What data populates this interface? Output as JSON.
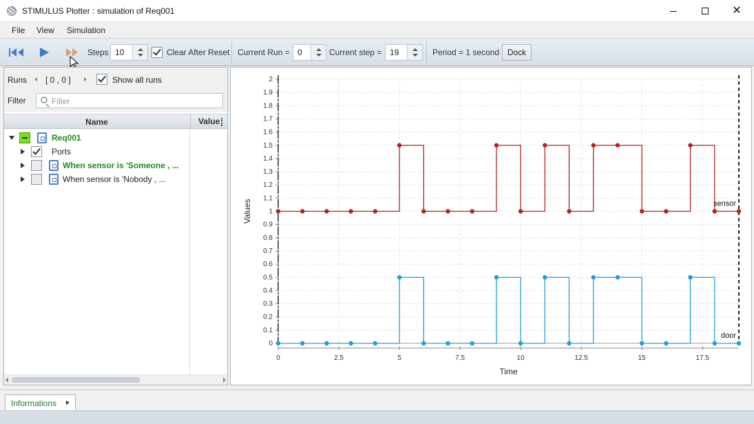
{
  "window": {
    "title": "STIMULUS Plotter : simulation of Req001"
  },
  "menu": {
    "items": [
      "File",
      "View",
      "Simulation"
    ]
  },
  "toolbar": {
    "steps_label": "Steps",
    "steps_value": "10",
    "clear_after_reset_label": "Clear After Reset",
    "clear_after_reset_checked": true,
    "current_run_label": "Current Run =",
    "current_run_value": "0",
    "current_step_label": "Current step =",
    "current_step_value": "19",
    "period_label": "Period = 1 second",
    "dock_label": "Dock",
    "icons": [
      "rewind-icon",
      "play-icon",
      "fast-forward-icon"
    ]
  },
  "runs_panel": {
    "runs_label": "Runs",
    "runs_range": "[ 0 , 0 ]",
    "show_all_runs_label": "Show all runs",
    "show_all_runs_checked": true,
    "filter_label": "Filter",
    "filter_placeholder": "Filter",
    "columns": {
      "name": "Name",
      "value": "Value"
    },
    "tree": [
      {
        "label": "Req001",
        "expanded": true,
        "checked": "partial",
        "bold": true,
        "color": "#1f8a1f"
      },
      {
        "label": "Ports",
        "expanded": false,
        "checked": true,
        "bold": false
      },
      {
        "label": "When  sensor is  'Someone , ...",
        "expanded": false,
        "checked": false,
        "bold": true,
        "color": "#1f8a1f"
      },
      {
        "label": "When  sensor is  'Nobody , ...",
        "expanded": false,
        "checked": false,
        "bold": false
      }
    ]
  },
  "info_tab": {
    "label": "Informations"
  },
  "colors": {
    "sensor": "#b22222",
    "door": "#1e9fd3",
    "accent_green": "#1f8a1f"
  },
  "chart_data": {
    "type": "line",
    "step": true,
    "xlabel": "Time",
    "ylabel": "Values",
    "xlim": [
      0,
      19
    ],
    "ylim": [
      0,
      2
    ],
    "x_ticks": [
      "0",
      "2.5",
      "5",
      "7.5",
      "10",
      "12.5",
      "15",
      "17.5"
    ],
    "y_ticks": [
      "0",
      "0.1",
      "0.2",
      "0.3",
      "0.4",
      "0.5",
      "0.6",
      "0.7",
      "0.8",
      "0.9",
      "1",
      "1.1",
      "1.2",
      "1.3",
      "1.4",
      "1.5",
      "1.6",
      "1.7",
      "1.8",
      "1.9",
      "2"
    ],
    "grid": true,
    "series": [
      {
        "name": "sensor",
        "x": [
          0,
          1,
          2,
          3,
          4,
          5,
          6,
          7,
          8,
          9,
          10,
          11,
          12,
          13,
          14,
          15,
          16,
          17,
          18,
          19
        ],
        "values": [
          1,
          1,
          1,
          1,
          1,
          1.5,
          1,
          1,
          1,
          1.5,
          1,
          1.5,
          1,
          1.5,
          1.5,
          1,
          1,
          1.5,
          1,
          1
        ]
      },
      {
        "name": "door",
        "x": [
          0,
          1,
          2,
          3,
          4,
          5,
          6,
          7,
          8,
          9,
          10,
          11,
          12,
          13,
          14,
          15,
          16,
          17,
          18,
          19
        ],
        "values": [
          0,
          0,
          0,
          0,
          0,
          0.5,
          0,
          0,
          0,
          0.5,
          0,
          0.5,
          0,
          0.5,
          0.5,
          0,
          0,
          0.5,
          0,
          0
        ]
      }
    ]
  }
}
